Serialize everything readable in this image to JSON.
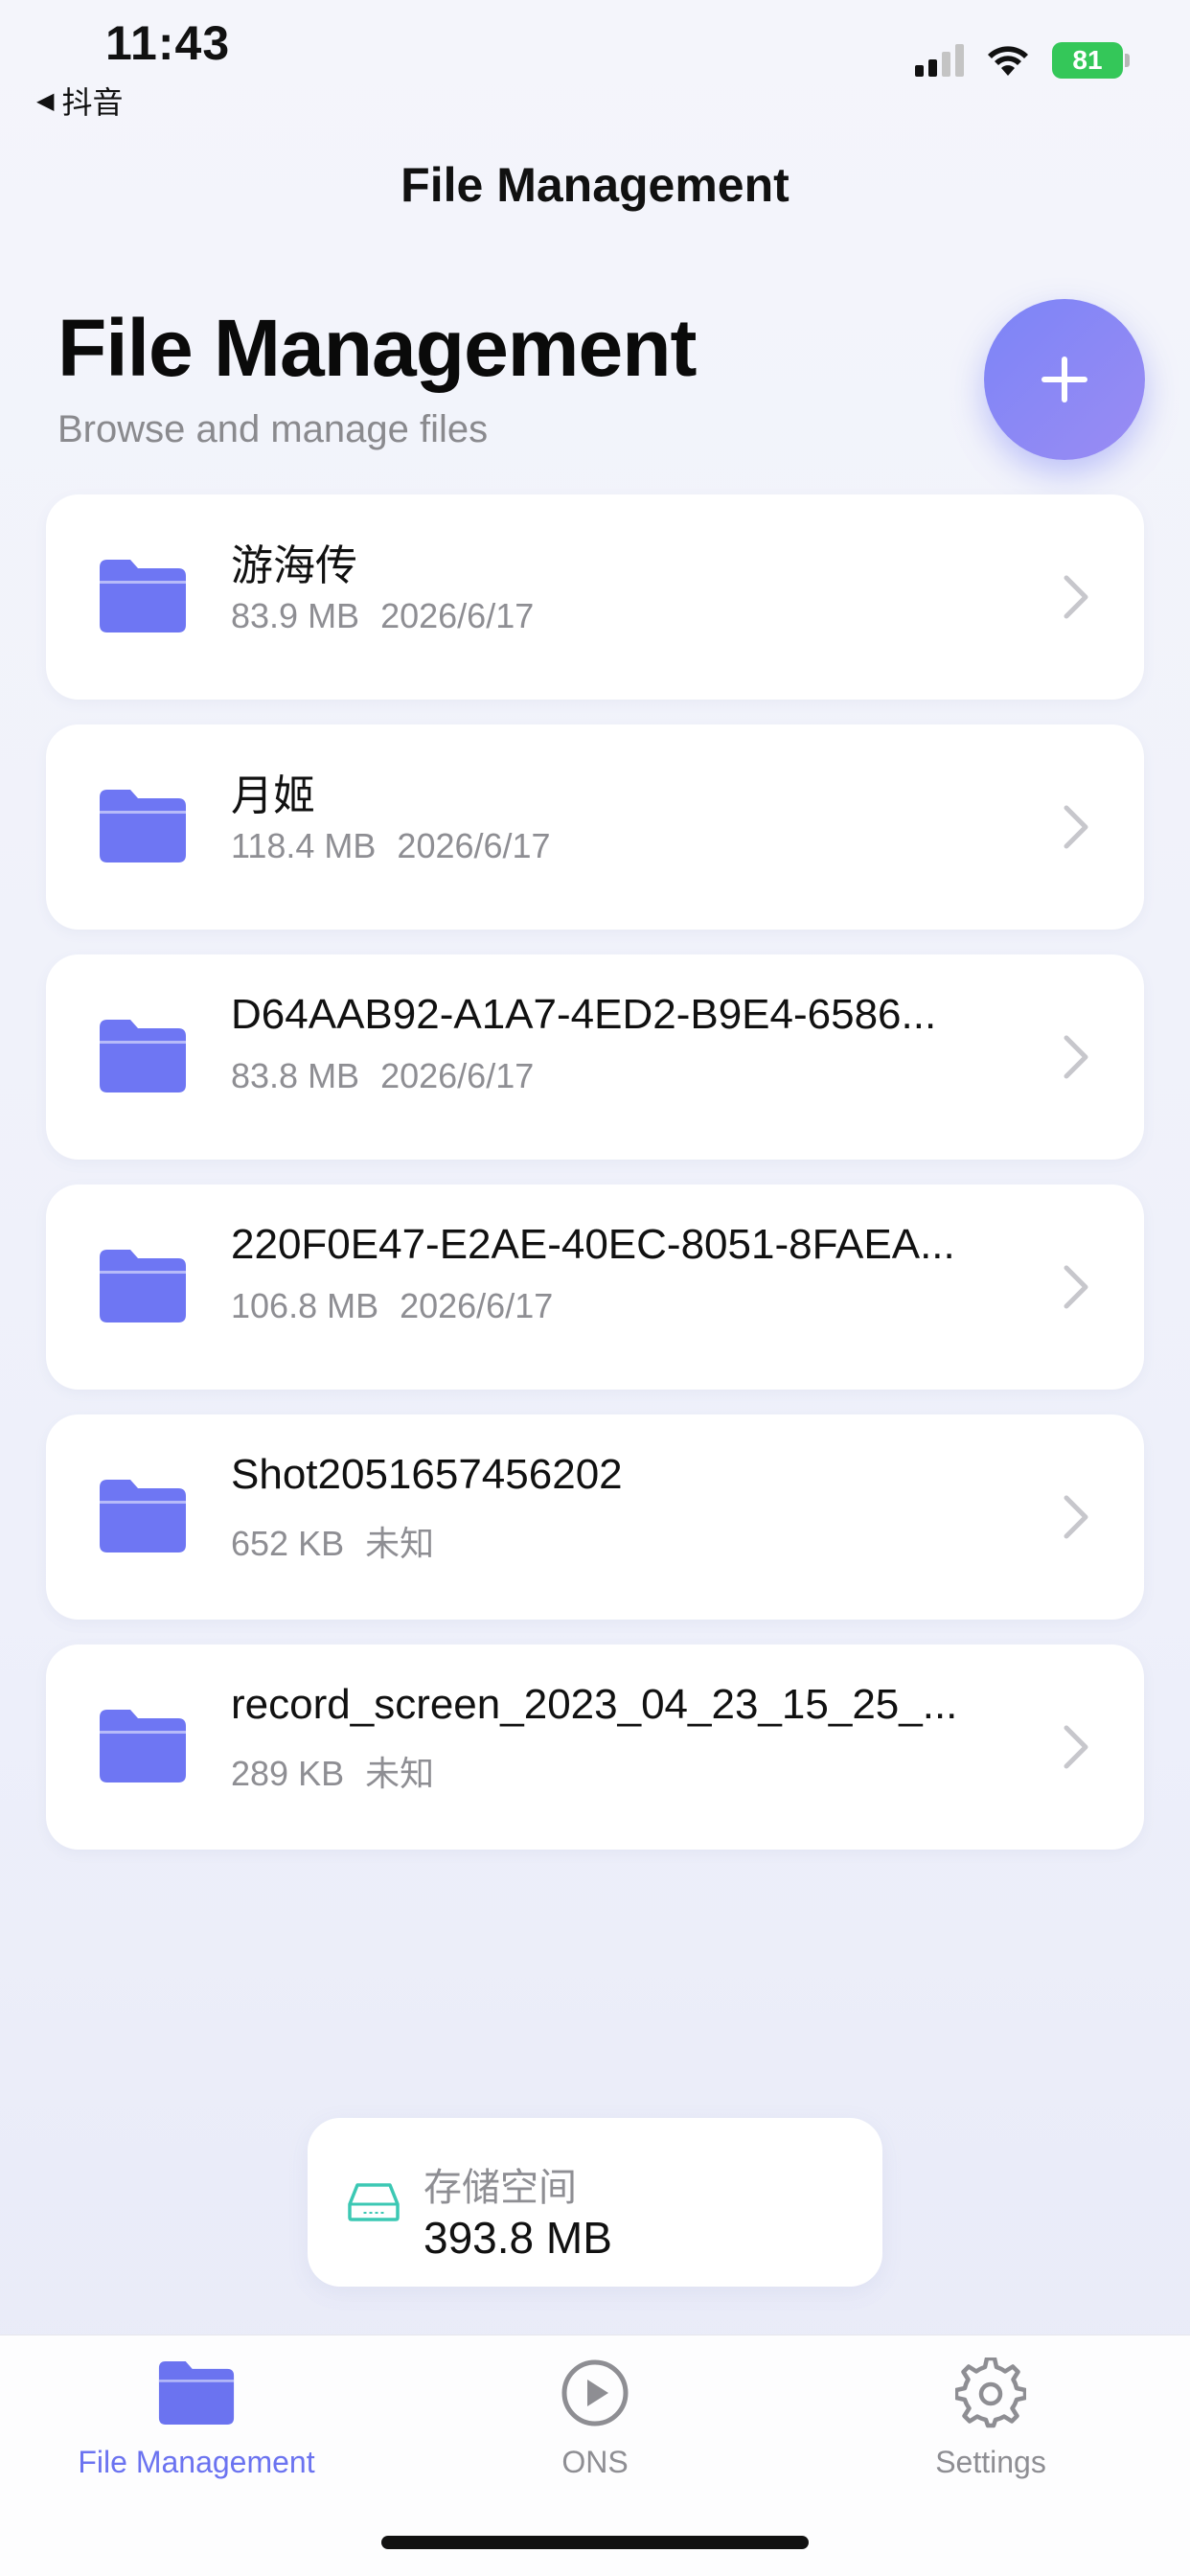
{
  "status_bar": {
    "time": "11:43",
    "back_app": "抖音",
    "battery": "81"
  },
  "nav": {
    "title": "File Management"
  },
  "header": {
    "title": "File Management",
    "subtitle": "Browse and manage files"
  },
  "files": [
    {
      "name": "游海传",
      "size": "83.9 MB",
      "date": "2026/6/17"
    },
    {
      "name": "月姬",
      "size": "118.4 MB",
      "date": "2026/6/17"
    },
    {
      "name": "D64AAB92-A1A7-4ED2-B9E4-6586...",
      "size": "83.8 MB",
      "date": "2026/6/17"
    },
    {
      "name": "220F0E47-E2AE-40EC-8051-8FAEA...",
      "size": "106.8 MB",
      "date": "2026/6/17"
    },
    {
      "name": "Shot2051657456202",
      "size": "652 KB",
      "date": "未知"
    },
    {
      "name": "record_screen_2023_04_23_15_25_...",
      "size": "289 KB",
      "date": "未知"
    }
  ],
  "storage": {
    "label": "存储空间",
    "value": "393.8 MB"
  },
  "tabs": [
    {
      "label": "File Management",
      "icon": "folder-icon",
      "active": true
    },
    {
      "label": "ONS",
      "icon": "play-circle-icon",
      "active": false
    },
    {
      "label": "Settings",
      "icon": "gear-icon",
      "active": false
    }
  ],
  "colors": {
    "accent": "#6b73f0",
    "folder": "#6e76f3",
    "storage_icon": "#3cc8b4"
  }
}
